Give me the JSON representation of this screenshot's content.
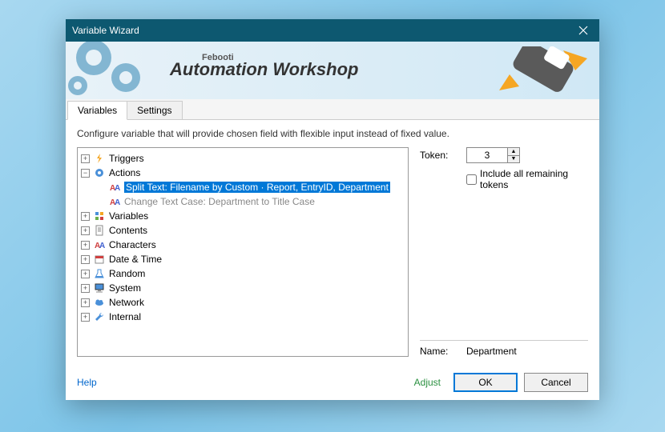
{
  "titlebar": {
    "title": "Variable Wizard"
  },
  "banner": {
    "subtitle": "Febooti",
    "title": "Automation Workshop"
  },
  "tabs": {
    "variables": "Variables",
    "settings": "Settings"
  },
  "description": "Configure variable that will provide chosen field with flexible input instead of fixed value.",
  "tree": {
    "triggers": "Triggers",
    "actions": "Actions",
    "action_split": "Split Text: Filename by Custom · Report, EntryID, Department",
    "action_case": "Change Text Case: Department to Title Case",
    "variables": "Variables",
    "contents": "Contents",
    "characters": "Characters",
    "datetime": "Date & Time",
    "random": "Random",
    "system": "System",
    "network": "Network",
    "internal": "Internal"
  },
  "side": {
    "token_label": "Token:",
    "token_value": "3",
    "include_label": "Include all remaining tokens",
    "include_checked": false,
    "name_label": "Name:",
    "name_value": "Department"
  },
  "footer": {
    "help": "Help",
    "adjust": "Adjust",
    "ok": "OK",
    "cancel": "Cancel"
  }
}
